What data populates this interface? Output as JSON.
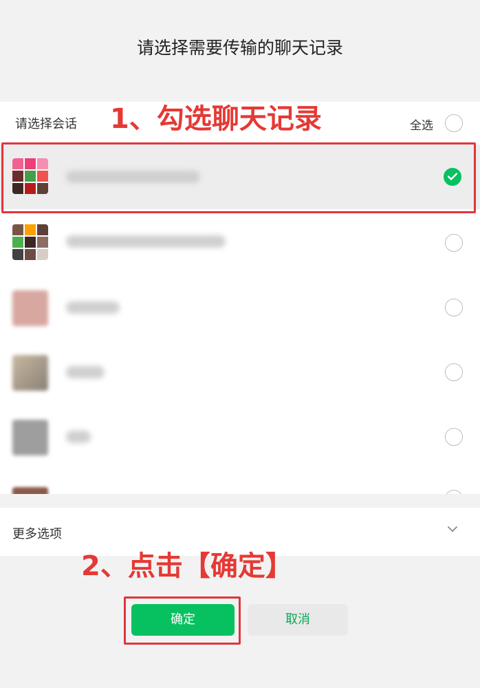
{
  "dialog": {
    "title": "请选择需要传输的聊天记录"
  },
  "list": {
    "header_label": "请选择会话",
    "select_all_label": "全选",
    "rows": [
      {
        "checked": true
      },
      {
        "checked": false
      },
      {
        "checked": false
      },
      {
        "checked": false
      },
      {
        "checked": false
      },
      {
        "checked": false
      }
    ]
  },
  "more_options": {
    "label": "更多选项",
    "icon": "chevron-down-icon"
  },
  "buttons": {
    "confirm_label": "确定",
    "cancel_label": "取消"
  },
  "annotations": {
    "step1": "1、勾选聊天记录",
    "step2": "2、点击【确定】"
  },
  "colors": {
    "accent_green": "#07c160",
    "annotation_red": "#e53935"
  }
}
